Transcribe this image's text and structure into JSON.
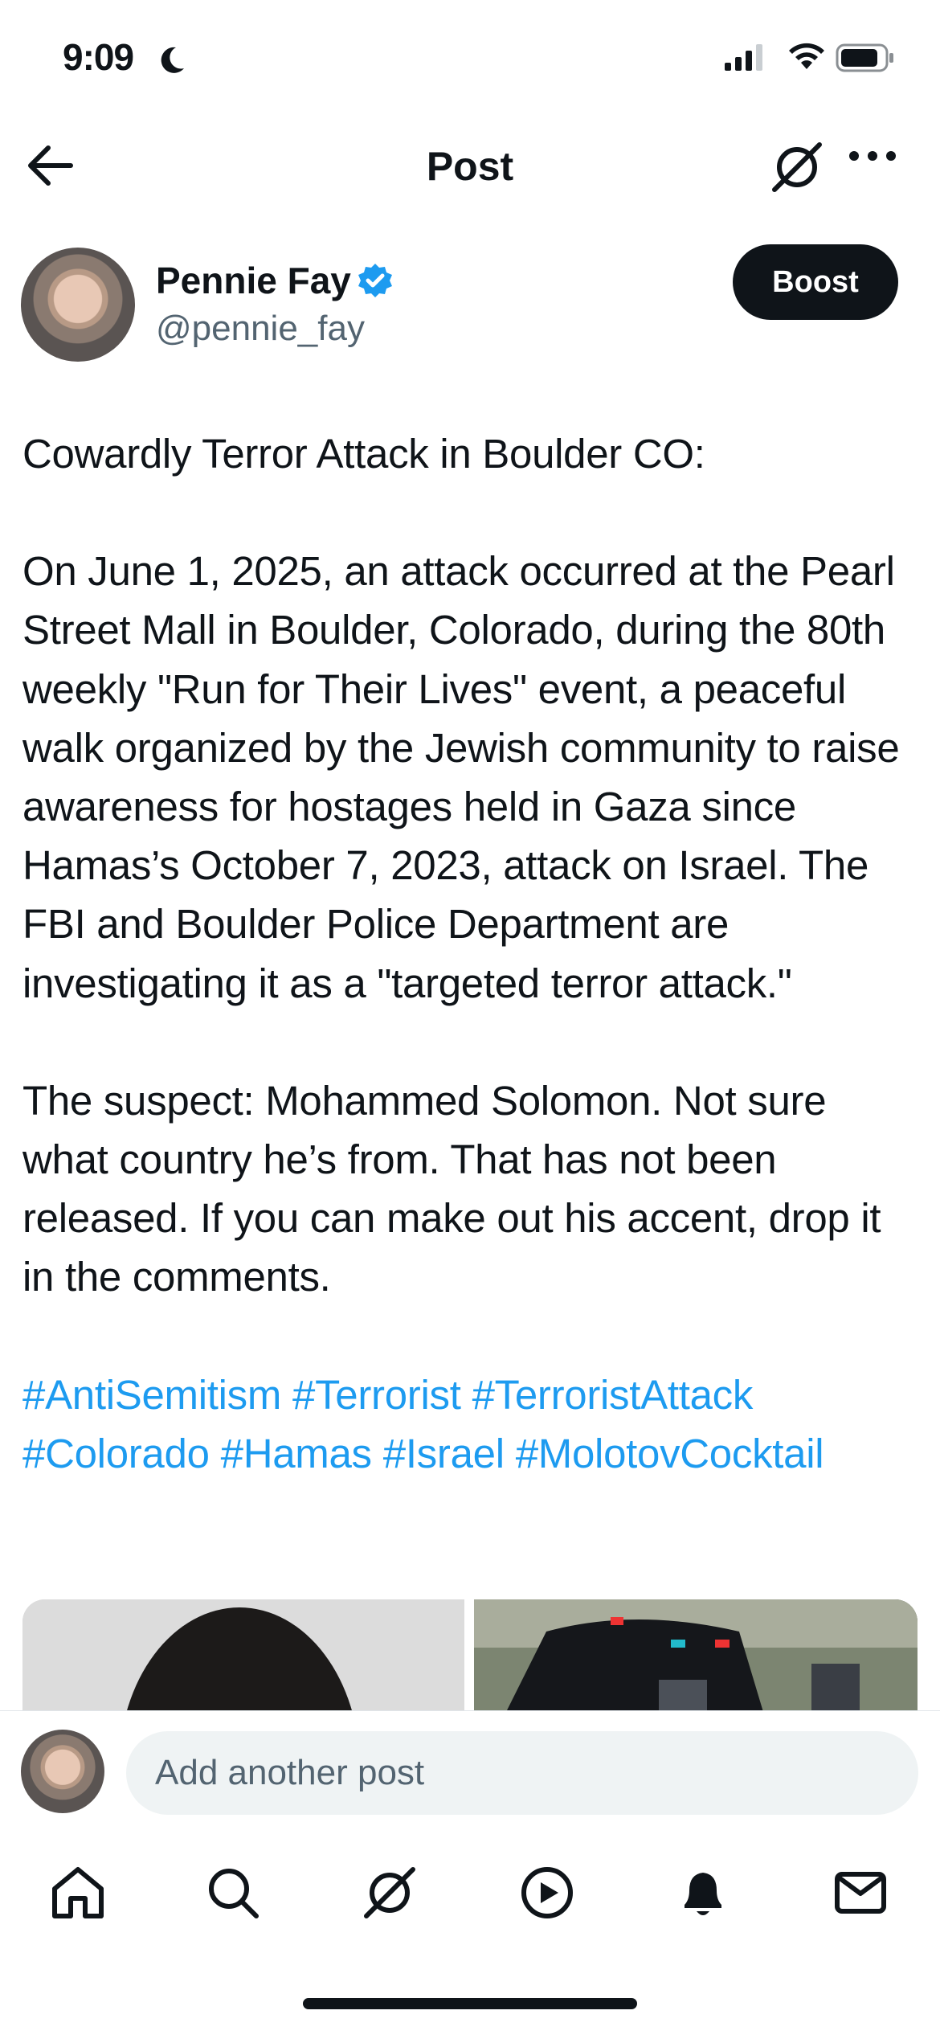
{
  "status_bar": {
    "time": "9:09"
  },
  "header": {
    "title": "Post"
  },
  "author": {
    "name": "Pennie Fay",
    "handle": "@pennie_fay",
    "boost_label": "Boost"
  },
  "post": {
    "paragraphs": [
      "Cowardly Terror Attack in Boulder CO:",
      "On June 1, 2025, an attack occurred at the Pearl Street Mall in Boulder, Colorado, during the 80th weekly \"Run for Their Lives\" event, a peaceful walk organized by the Jewish community to raise awareness for hostages held in Gaza since Hamas’s October 7, 2023, attack on Israel. The FBI and Boulder Police Department are investigating it as a \"targeted terror attack.\"",
      "The suspect: Mohammed Solomon. Not sure what country he’s from. That has not been released. If you can make out his accent, drop it in the comments."
    ],
    "hashtags": [
      "#AntiSemitism",
      "#Terrorist",
      "#TerroristAttack",
      "#Colorado",
      "#Hamas",
      "#Israel",
      "#MolotovCocktail"
    ]
  },
  "reply": {
    "placeholder": "Add another post"
  },
  "colors": {
    "accent": "#1d9bf0",
    "text": "#0f1419",
    "secondary": "#536471"
  },
  "nav_icons": [
    "home-icon",
    "search-icon",
    "grok-icon",
    "play-icon",
    "bell-icon",
    "mail-icon"
  ]
}
